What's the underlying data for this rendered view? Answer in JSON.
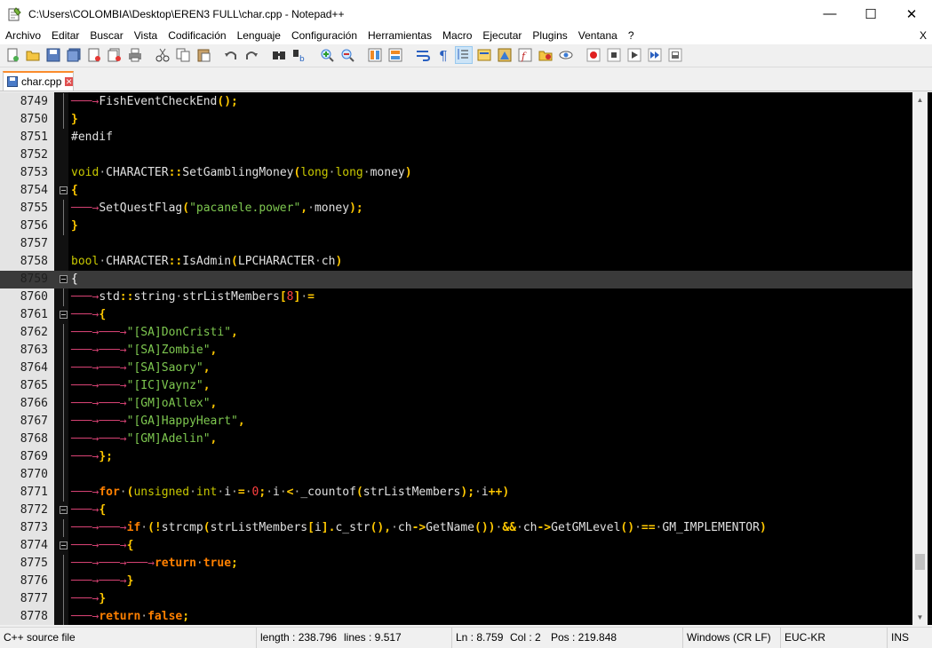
{
  "window": {
    "title": "C:\\Users\\COLOMBIA\\Desktop\\EREN3 FULL\\char.cpp - Notepad++"
  },
  "window_controls": {
    "minimize": "—",
    "maximize": "☐",
    "close": "✕"
  },
  "menu": [
    "Archivo",
    "Editar",
    "Buscar",
    "Vista",
    "Codificación",
    "Lenguaje",
    "Configuración",
    "Herramientas",
    "Macro",
    "Ejecutar",
    "Plugins",
    "Ventana",
    "?"
  ],
  "menu_close": "X",
  "tab": {
    "label": "char.cpp"
  },
  "editor": {
    "colors": {
      "background": "#000000",
      "keyword": "#ff8000",
      "type": "#c8c800",
      "string": "#7ec850",
      "number": "#ff4040",
      "operator": "#ffc800",
      "tab_arrow": "#d04070",
      "current_line": "#3a3a3a"
    },
    "lines": [
      {
        "num": "8749",
        "fold": "line",
        "current": false,
        "tokens": [
          [
            "arr",
            "⟶"
          ],
          [
            "p",
            "FishEventCheckEnd"
          ],
          [
            "o",
            "()"
          ],
          [
            "o",
            ";"
          ]
        ]
      },
      {
        "num": "8750",
        "fold": "line",
        "current": false,
        "tokens": [
          [
            "o",
            "}"
          ]
        ]
      },
      {
        "num": "8751",
        "fold": "none",
        "current": false,
        "tokens": [
          [
            "p",
            "#endif"
          ]
        ]
      },
      {
        "num": "8752",
        "fold": "none",
        "current": false,
        "tokens": []
      },
      {
        "num": "8753",
        "fold": "none",
        "current": false,
        "tokens": [
          [
            "t",
            "void"
          ],
          [
            "w",
            "·"
          ],
          [
            "p",
            "CHARACTER"
          ],
          [
            "o",
            "::"
          ],
          [
            "p",
            "SetGamblingMoney"
          ],
          [
            "o",
            "("
          ],
          [
            "t",
            "long"
          ],
          [
            "w",
            "·"
          ],
          [
            "t",
            "long"
          ],
          [
            "w",
            "·"
          ],
          [
            "p",
            "money"
          ],
          [
            "o",
            ")"
          ]
        ]
      },
      {
        "num": "8754",
        "fold": "box",
        "current": false,
        "tokens": [
          [
            "o",
            "{"
          ]
        ]
      },
      {
        "num": "8755",
        "fold": "line",
        "current": false,
        "tokens": [
          [
            "arr",
            "⟶"
          ],
          [
            "p",
            "SetQuestFlag"
          ],
          [
            "o",
            "("
          ],
          [
            "s",
            "\"pacanele.power\""
          ],
          [
            "o",
            ","
          ],
          [
            "w",
            "·"
          ],
          [
            "p",
            "money"
          ],
          [
            "o",
            ")"
          ],
          [
            "o",
            ";"
          ]
        ]
      },
      {
        "num": "8756",
        "fold": "line",
        "current": false,
        "tokens": [
          [
            "o",
            "}"
          ]
        ]
      },
      {
        "num": "8757",
        "fold": "none",
        "current": false,
        "tokens": []
      },
      {
        "num": "8758",
        "fold": "none",
        "current": false,
        "tokens": [
          [
            "t",
            "bool"
          ],
          [
            "w",
            "·"
          ],
          [
            "p",
            "CHARACTER"
          ],
          [
            "o",
            "::"
          ],
          [
            "p",
            "IsAdmin"
          ],
          [
            "o",
            "("
          ],
          [
            "p",
            "LPCHARACTER"
          ],
          [
            "w",
            "·"
          ],
          [
            "p",
            "ch"
          ],
          [
            "o",
            ")"
          ]
        ]
      },
      {
        "num": "8759",
        "fold": "box",
        "current": true,
        "tokens": [
          [
            "wh",
            "{"
          ]
        ]
      },
      {
        "num": "8760",
        "fold": "line",
        "current": false,
        "tokens": [
          [
            "arr",
            "⟶"
          ],
          [
            "p",
            "std"
          ],
          [
            "o",
            "::"
          ],
          [
            "p",
            "string"
          ],
          [
            "w",
            "·"
          ],
          [
            "p",
            "strListMembers"
          ],
          [
            "o",
            "["
          ],
          [
            "n",
            "8"
          ],
          [
            "o",
            "]"
          ],
          [
            "w",
            "·"
          ],
          [
            "o",
            "="
          ]
        ]
      },
      {
        "num": "8761",
        "fold": "box",
        "current": false,
        "tokens": [
          [
            "arr",
            "⟶"
          ],
          [
            "o",
            "{"
          ]
        ]
      },
      {
        "num": "8762",
        "fold": "line",
        "current": false,
        "tokens": [
          [
            "arr",
            "⟶"
          ],
          [
            "arr",
            "⟶"
          ],
          [
            "s",
            "\"[SA]DonCristi\""
          ],
          [
            "o",
            ","
          ]
        ]
      },
      {
        "num": "8763",
        "fold": "line",
        "current": false,
        "tokens": [
          [
            "arr",
            "⟶"
          ],
          [
            "arr",
            "⟶"
          ],
          [
            "s",
            "\"[SA]Zombie\""
          ],
          [
            "o",
            ","
          ]
        ]
      },
      {
        "num": "8764",
        "fold": "line",
        "current": false,
        "tokens": [
          [
            "arr",
            "⟶"
          ],
          [
            "arr",
            "⟶"
          ],
          [
            "s",
            "\"[SA]Saory\""
          ],
          [
            "o",
            ","
          ]
        ]
      },
      {
        "num": "8765",
        "fold": "line",
        "current": false,
        "tokens": [
          [
            "arr",
            "⟶"
          ],
          [
            "arr",
            "⟶"
          ],
          [
            "s",
            "\"[IC]Vaynz\""
          ],
          [
            "o",
            ","
          ]
        ]
      },
      {
        "num": "8766",
        "fold": "line",
        "current": false,
        "tokens": [
          [
            "arr",
            "⟶"
          ],
          [
            "arr",
            "⟶"
          ],
          [
            "s",
            "\"[GM]oAllex\""
          ],
          [
            "o",
            ","
          ]
        ]
      },
      {
        "num": "8767",
        "fold": "line",
        "current": false,
        "tokens": [
          [
            "arr",
            "⟶"
          ],
          [
            "arr",
            "⟶"
          ],
          [
            "s",
            "\"[GA]HappyHeart\""
          ],
          [
            "o",
            ","
          ]
        ]
      },
      {
        "num": "8768",
        "fold": "line",
        "current": false,
        "tokens": [
          [
            "arr",
            "⟶"
          ],
          [
            "arr",
            "⟶"
          ],
          [
            "s",
            "\"[GM]Adelin\""
          ],
          [
            "o",
            ","
          ]
        ]
      },
      {
        "num": "8769",
        "fold": "line",
        "current": false,
        "tokens": [
          [
            "arr",
            "⟶"
          ],
          [
            "o",
            "}"
          ],
          [
            "o",
            ";"
          ]
        ]
      },
      {
        "num": "8770",
        "fold": "line",
        "current": false,
        "tokens": []
      },
      {
        "num": "8771",
        "fold": "line",
        "current": false,
        "tokens": [
          [
            "arr",
            "⟶"
          ],
          [
            "k",
            "for"
          ],
          [
            "w",
            "·"
          ],
          [
            "o",
            "("
          ],
          [
            "t",
            "unsigned"
          ],
          [
            "w",
            "·"
          ],
          [
            "t",
            "int"
          ],
          [
            "w",
            "·"
          ],
          [
            "p",
            "i"
          ],
          [
            "w",
            "·"
          ],
          [
            "o",
            "="
          ],
          [
            "w",
            "·"
          ],
          [
            "n",
            "0"
          ],
          [
            "o",
            ";"
          ],
          [
            "w",
            "·"
          ],
          [
            "p",
            "i"
          ],
          [
            "w",
            "·"
          ],
          [
            "o",
            "<"
          ],
          [
            "w",
            "·"
          ],
          [
            "p",
            "_countof"
          ],
          [
            "o",
            "("
          ],
          [
            "p",
            "strListMembers"
          ],
          [
            "o",
            ")"
          ],
          [
            "o",
            ";"
          ],
          [
            "w",
            "·"
          ],
          [
            "p",
            "i"
          ],
          [
            "o",
            "++"
          ],
          [
            "o",
            ")"
          ]
        ]
      },
      {
        "num": "8772",
        "fold": "box",
        "current": false,
        "tokens": [
          [
            "arr",
            "⟶"
          ],
          [
            "o",
            "{"
          ]
        ]
      },
      {
        "num": "8773",
        "fold": "line",
        "current": false,
        "tokens": [
          [
            "arr",
            "⟶"
          ],
          [
            "arr",
            "⟶"
          ],
          [
            "k",
            "if"
          ],
          [
            "w",
            "·"
          ],
          [
            "o",
            "(!"
          ],
          [
            "p",
            "strcmp"
          ],
          [
            "o",
            "("
          ],
          [
            "p",
            "strListMembers"
          ],
          [
            "o",
            "["
          ],
          [
            "p",
            "i"
          ],
          [
            "o",
            "]."
          ],
          [
            "p",
            "c_str"
          ],
          [
            "o",
            "()"
          ],
          [
            "o",
            ","
          ],
          [
            "w",
            "·"
          ],
          [
            "p",
            "ch"
          ],
          [
            "o",
            "->"
          ],
          [
            "p",
            "GetName"
          ],
          [
            "o",
            "())"
          ],
          [
            "w",
            "·"
          ],
          [
            "o",
            "&&"
          ],
          [
            "w",
            "·"
          ],
          [
            "p",
            "ch"
          ],
          [
            "o",
            "->"
          ],
          [
            "p",
            "GetGMLevel"
          ],
          [
            "o",
            "()"
          ],
          [
            "w",
            "·"
          ],
          [
            "o",
            "=="
          ],
          [
            "w",
            "·"
          ],
          [
            "p",
            "GM_IMPLEMENTOR"
          ],
          [
            "o",
            ")"
          ]
        ]
      },
      {
        "num": "8774",
        "fold": "box",
        "current": false,
        "tokens": [
          [
            "arr",
            "⟶"
          ],
          [
            "arr",
            "⟶"
          ],
          [
            "o",
            "{"
          ]
        ]
      },
      {
        "num": "8775",
        "fold": "line",
        "current": false,
        "tokens": [
          [
            "arr",
            "⟶"
          ],
          [
            "arr",
            "⟶"
          ],
          [
            "arr",
            "⟶"
          ],
          [
            "k",
            "return"
          ],
          [
            "w",
            "·"
          ],
          [
            "k",
            "true"
          ],
          [
            "o",
            ";"
          ]
        ]
      },
      {
        "num": "8776",
        "fold": "line",
        "current": false,
        "tokens": [
          [
            "arr",
            "⟶"
          ],
          [
            "arr",
            "⟶"
          ],
          [
            "o",
            "}"
          ]
        ]
      },
      {
        "num": "8777",
        "fold": "line",
        "current": false,
        "tokens": [
          [
            "arr",
            "⟶"
          ],
          [
            "o",
            "}"
          ]
        ]
      },
      {
        "num": "8778",
        "fold": "line",
        "current": false,
        "tokens": [
          [
            "arr",
            "⟶"
          ],
          [
            "k",
            "return"
          ],
          [
            "w",
            "·"
          ],
          [
            "k",
            "false"
          ],
          [
            "o",
            ";"
          ]
        ]
      }
    ]
  },
  "status": {
    "filetype": "C++ source file",
    "length": "length : 238.796",
    "lines": "lines : 9.517",
    "ln": "Ln : 8.759",
    "col": "Col : 2",
    "pos": "Pos : 219.848",
    "eol": "Windows (CR LF)",
    "encoding": "EUC-KR",
    "mode": "INS"
  }
}
